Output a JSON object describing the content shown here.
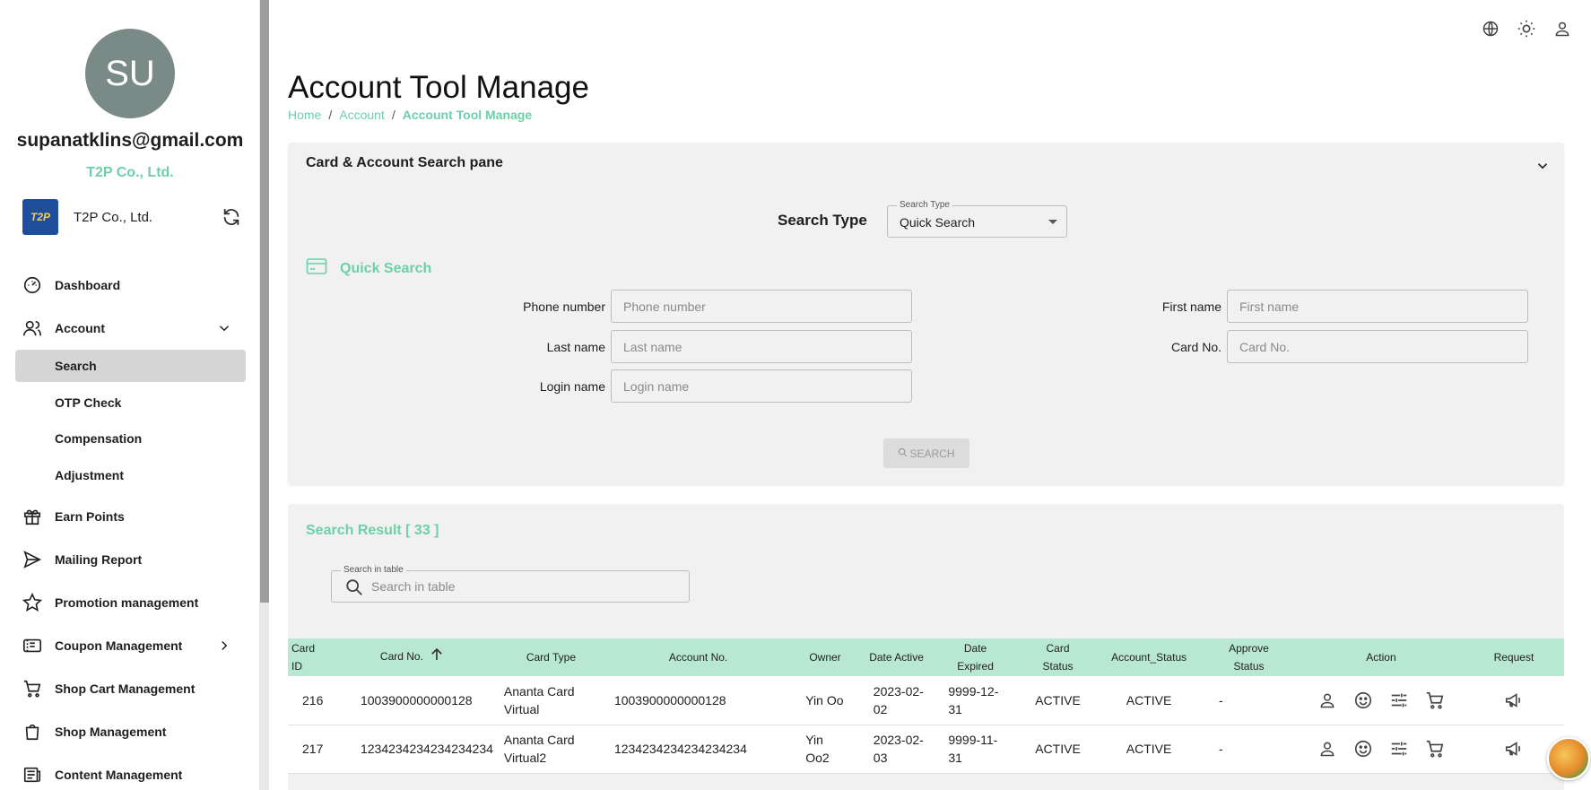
{
  "user": {
    "avatar_initials": "SU",
    "email": "supanatklins@gmail.com",
    "company": "T2P Co., Ltd."
  },
  "company_switcher": {
    "logo_text": "T2P",
    "name": "T2P Co., Ltd."
  },
  "sidebar": {
    "items": [
      {
        "label": "Dashboard",
        "icon": "dashboard-icon"
      },
      {
        "label": "Account",
        "icon": "users-icon"
      },
      {
        "label": "Search"
      },
      {
        "label": "OTP Check"
      },
      {
        "label": "Compensation"
      },
      {
        "label": "Adjustment"
      },
      {
        "label": "Earn Points",
        "icon": "gift-icon"
      },
      {
        "label": "Mailing Report",
        "icon": "send-icon"
      },
      {
        "label": "Promotion management",
        "icon": "star-icon"
      },
      {
        "label": "Coupon Management",
        "icon": "coupon-icon"
      },
      {
        "label": "Shop Cart Management",
        "icon": "cart-icon"
      },
      {
        "label": "Shop Management",
        "icon": "bag-icon"
      },
      {
        "label": "Content Management",
        "icon": "newspaper-icon"
      }
    ]
  },
  "header": {
    "title": "Account Tool Manage",
    "breadcrumb": [
      "Home",
      "Account",
      "Account Tool Manage"
    ],
    "breadcrumb_sep": "/"
  },
  "search_pane": {
    "title": "Card & Account Search pane",
    "search_type_label": "Search Type",
    "search_type_legend": "Search Type",
    "search_type_value": "Quick Search",
    "section_title": "Quick Search",
    "fields": {
      "phone_label": "Phone number",
      "phone_placeholder": "Phone number",
      "last_label": "Last name",
      "last_placeholder": "Last name",
      "login_label": "Login name",
      "login_placeholder": "Login name",
      "first_label": "First name",
      "first_placeholder": "First name",
      "card_label": "Card No.",
      "card_placeholder": "Card No."
    },
    "search_button": "SEARCH"
  },
  "results": {
    "title": "Search Result [ 33 ]",
    "table_search_legend": "Search in table",
    "table_search_placeholder": "Search in table",
    "columns": {
      "card_id_1": "Card",
      "card_id_2": "ID",
      "card_no": "Card No.",
      "card_type": "Card Type",
      "account_no": "Account No.",
      "owner": "Owner",
      "date_active": "Date Active",
      "date_expired_1": "Date",
      "date_expired_2": "Expired",
      "card_status_1": "Card",
      "card_status_2": "Status",
      "account_status": "Account_Status",
      "approve_status_1": "Approve",
      "approve_status_2": "Status",
      "action": "Action",
      "request": "Request"
    },
    "rows": [
      {
        "card_id": "216",
        "card_no": "1003900000000128",
        "card_type_1": "Ananta Card",
        "card_type_2": "Virtual",
        "account_no": "1003900000000128",
        "owner_1": "Yin Oo",
        "owner_2": "",
        "date_active_1": "2023-02-",
        "date_active_2": "02",
        "date_expired_1": "9999-12-",
        "date_expired_2": "31",
        "card_status": "ACTIVE",
        "account_status": "ACTIVE",
        "approve_status": "-"
      },
      {
        "card_id": "217",
        "card_no": "1234234234234234234",
        "card_type_1": "Ananta Card",
        "card_type_2": "Virtual2",
        "account_no": "1234234234234234234",
        "owner_1": "Yin",
        "owner_2": "Oo2",
        "date_active_1": "2023-02-",
        "date_active_2": "03",
        "date_expired_1": "9999-11-",
        "date_expired_2": "31",
        "card_status": "ACTIVE",
        "account_status": "ACTIVE",
        "approve_status": "-"
      }
    ]
  },
  "colors": {
    "accent": "#6ecfa9",
    "table_header": "#b9e8d2",
    "panel_bg": "#f2f1f1",
    "avatar_bg": "#7a8a86"
  }
}
